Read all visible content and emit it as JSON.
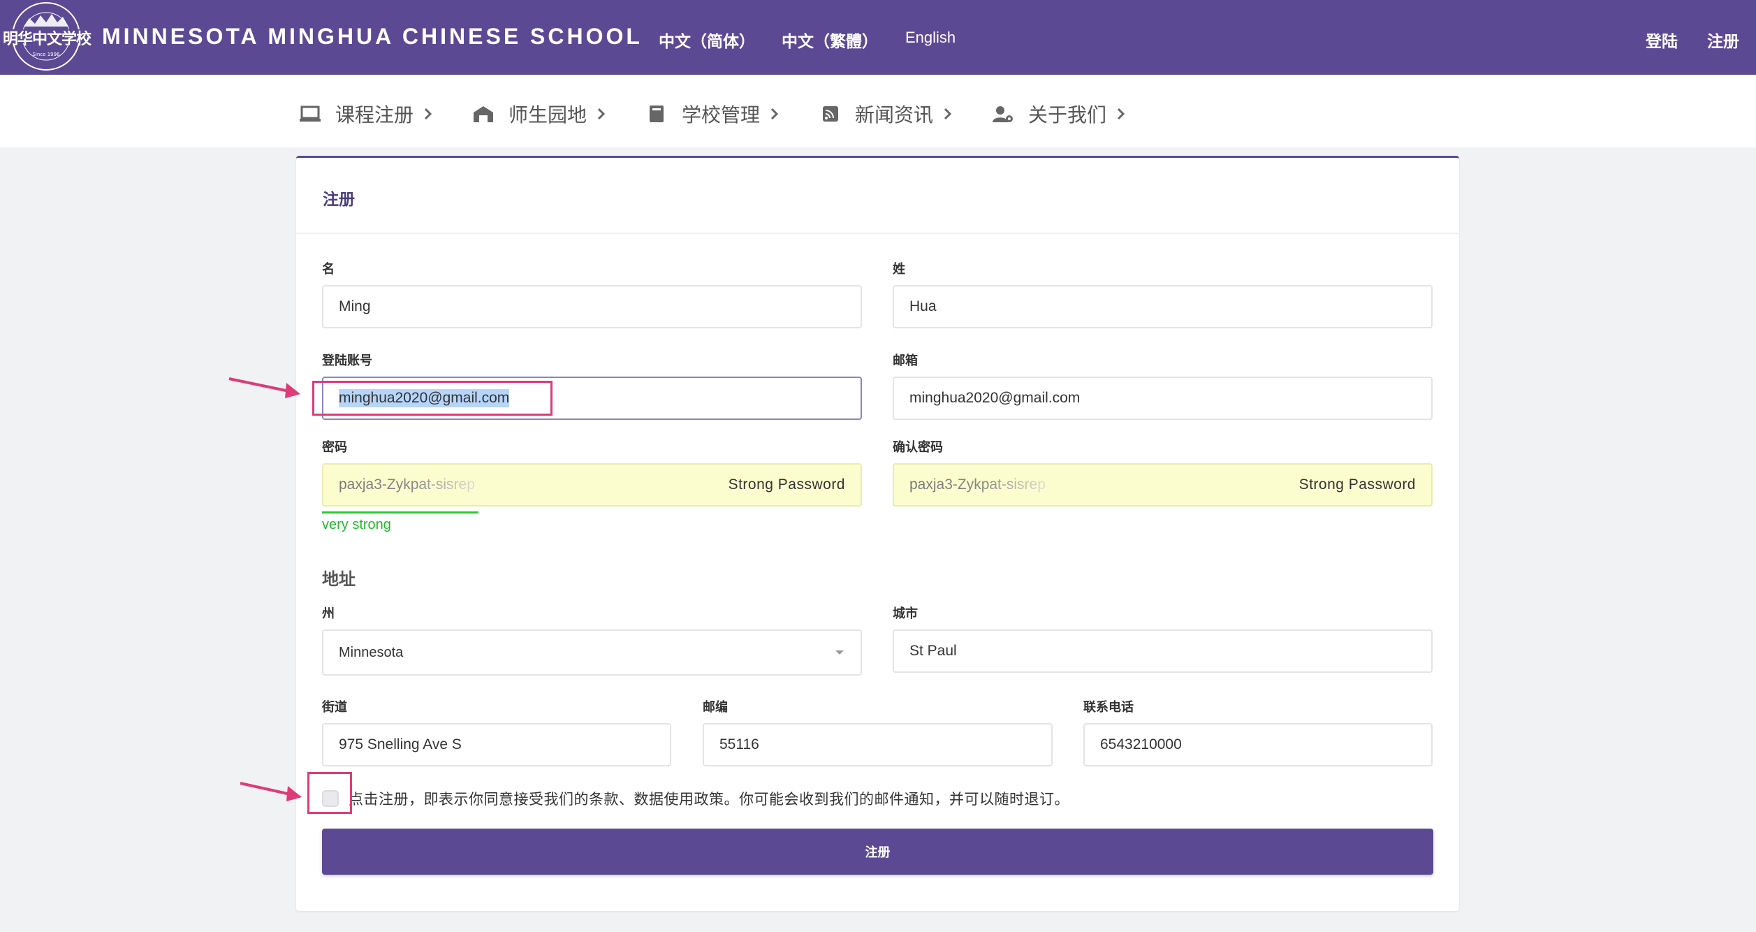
{
  "header": {
    "logo_text": "明华中文学校",
    "logo_ring_top": "MINNESOTA MINGHUA",
    "logo_ring_bottom": "CHINESE SCHOOL",
    "logo_since": "Since 1996",
    "brand": "MINNESOTA MINGHUA CHINESE SCHOOL",
    "languages": [
      "中文（简体）",
      "中文（繁體）",
      "English"
    ],
    "login": "登陆",
    "register": "注册"
  },
  "nav": {
    "items": [
      {
        "label": "课程注册",
        "icon": "laptop-icon"
      },
      {
        "label": "师生园地",
        "icon": "campus-icon"
      },
      {
        "label": "学校管理",
        "icon": "book-icon"
      },
      {
        "label": "新闻资讯",
        "icon": "rss-icon"
      },
      {
        "label": "关于我们",
        "icon": "user-gear-icon"
      }
    ]
  },
  "form": {
    "title": "注册",
    "first_name": {
      "label": "名",
      "value": "Ming"
    },
    "last_name": {
      "label": "姓",
      "value": "Hua"
    },
    "username": {
      "label": "登陆账号",
      "value": "minghua2020@gmail.com"
    },
    "email": {
      "label": "邮箱",
      "value": "minghua2020@gmail.com"
    },
    "password": {
      "label": "密码",
      "value": "paxja3-Zykpat-sisrep",
      "badge": "Strong Password"
    },
    "confirm_password": {
      "label": "确认密码",
      "value": "paxja3-Zykpat-sisrep",
      "badge": "Strong Password"
    },
    "strength": {
      "text": "very strong",
      "level": 0.25
    },
    "address_title": "地址",
    "state": {
      "label": "州",
      "value": "Minnesota"
    },
    "city": {
      "label": "城市",
      "value": "St Paul"
    },
    "street": {
      "label": "街道",
      "value": "975 Snelling Ave S"
    },
    "zip": {
      "label": "邮编",
      "value": "55116"
    },
    "phone": {
      "label": "联系电话",
      "value": "6543210000"
    },
    "agree_text": "点击注册，即表示你同意接受我们的条款、数据使用政策。你可能会收到我们的邮件通知，并可以随时退订。",
    "agree_checked": false,
    "submit_label": "注册"
  },
  "colors": {
    "brand": "#5b4a93",
    "annotation": "#de3b77",
    "strength": "#22cc33",
    "autofill": "#fbfdce"
  }
}
